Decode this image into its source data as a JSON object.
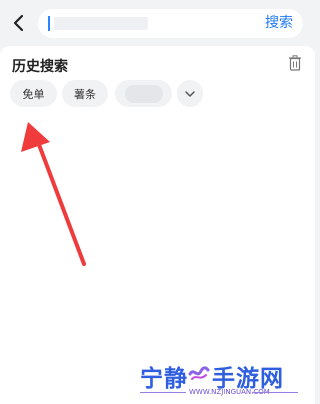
{
  "header": {
    "search_button": "搜索",
    "back_icon": "chevron-left-icon"
  },
  "history": {
    "title": "历史搜索",
    "delete_icon": "trash-icon",
    "chips": [
      "免单",
      "薯条"
    ],
    "more_icon": "chevron-down-icon"
  },
  "annotation": {
    "arrow_color": "#ef3b3b"
  },
  "watermark": {
    "main_part1": "宁静",
    "main_part2": "手游网",
    "url": "WWW.NZJINGUAN.COM"
  }
}
